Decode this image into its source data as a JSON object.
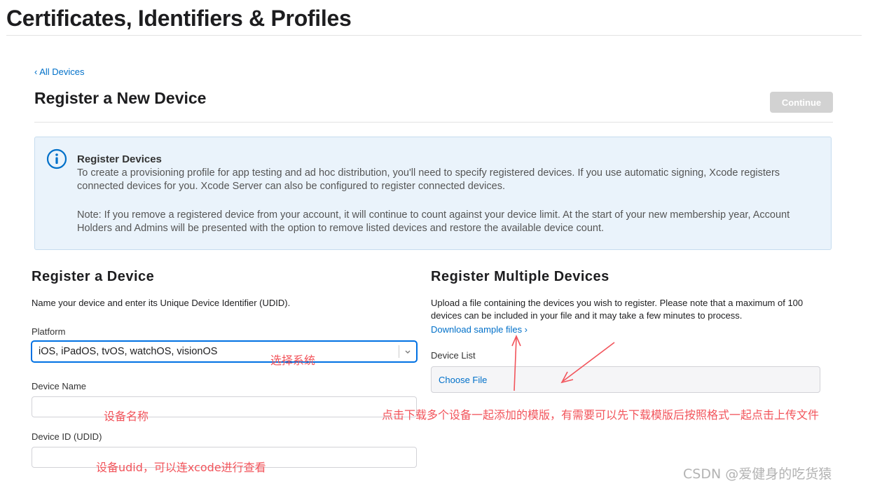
{
  "header": {
    "page_title": "Certificates, Identifiers & Profiles"
  },
  "nav": {
    "back_label": "‹ All Devices"
  },
  "section": {
    "title": "Register a New Device",
    "continue_label": "Continue"
  },
  "info": {
    "icon": "info-icon",
    "heading": "Register Devices",
    "paragraph1": "To create a provisioning profile for app testing and ad hoc distribution, you'll need to specify registered devices. If you use automatic signing, Xcode registers connected devices for you. Xcode Server can also be configured to register connected devices.",
    "paragraph2": "Note: If you remove a registered device from your account, it will continue to count against your device limit. At the start of your new membership year, Account Holders and Admins will be presented with the option to remove listed devices and restore the available device count."
  },
  "single": {
    "title": "Register a Device",
    "description": "Name your device and enter its Unique Device Identifier (UDID).",
    "platform_label": "Platform",
    "platform_value": "iOS, iPadOS, tvOS, watchOS, visionOS",
    "device_name_label": "Device Name",
    "device_name_value": "",
    "device_id_label": "Device ID (UDID)",
    "device_id_value": ""
  },
  "multiple": {
    "title": "Register Multiple Devices",
    "description": "Upload a file containing the devices you wish to register. Please note that a maximum of 100 devices can be included in your file and it may take a few minutes to process.",
    "download_link": "Download sample files ›",
    "device_list_label": "Device List",
    "choose_file_label": "Choose File"
  },
  "annotations": {
    "select_system": "选择系统",
    "device_name": "设备名称",
    "device_udid": "设备udid，可以连xcode进行查看",
    "download_template": "点击下载多个设备一起添加的模版，有需要可以先下载模版后按照格式一起点击上传文件",
    "color": "#f2545b"
  },
  "watermark": "CSDN @爱健身的吃货猿",
  "colors": {
    "link": "#0070c9",
    "info_background": "#eaf3fb",
    "disabled_button": "#d2d2d2"
  }
}
